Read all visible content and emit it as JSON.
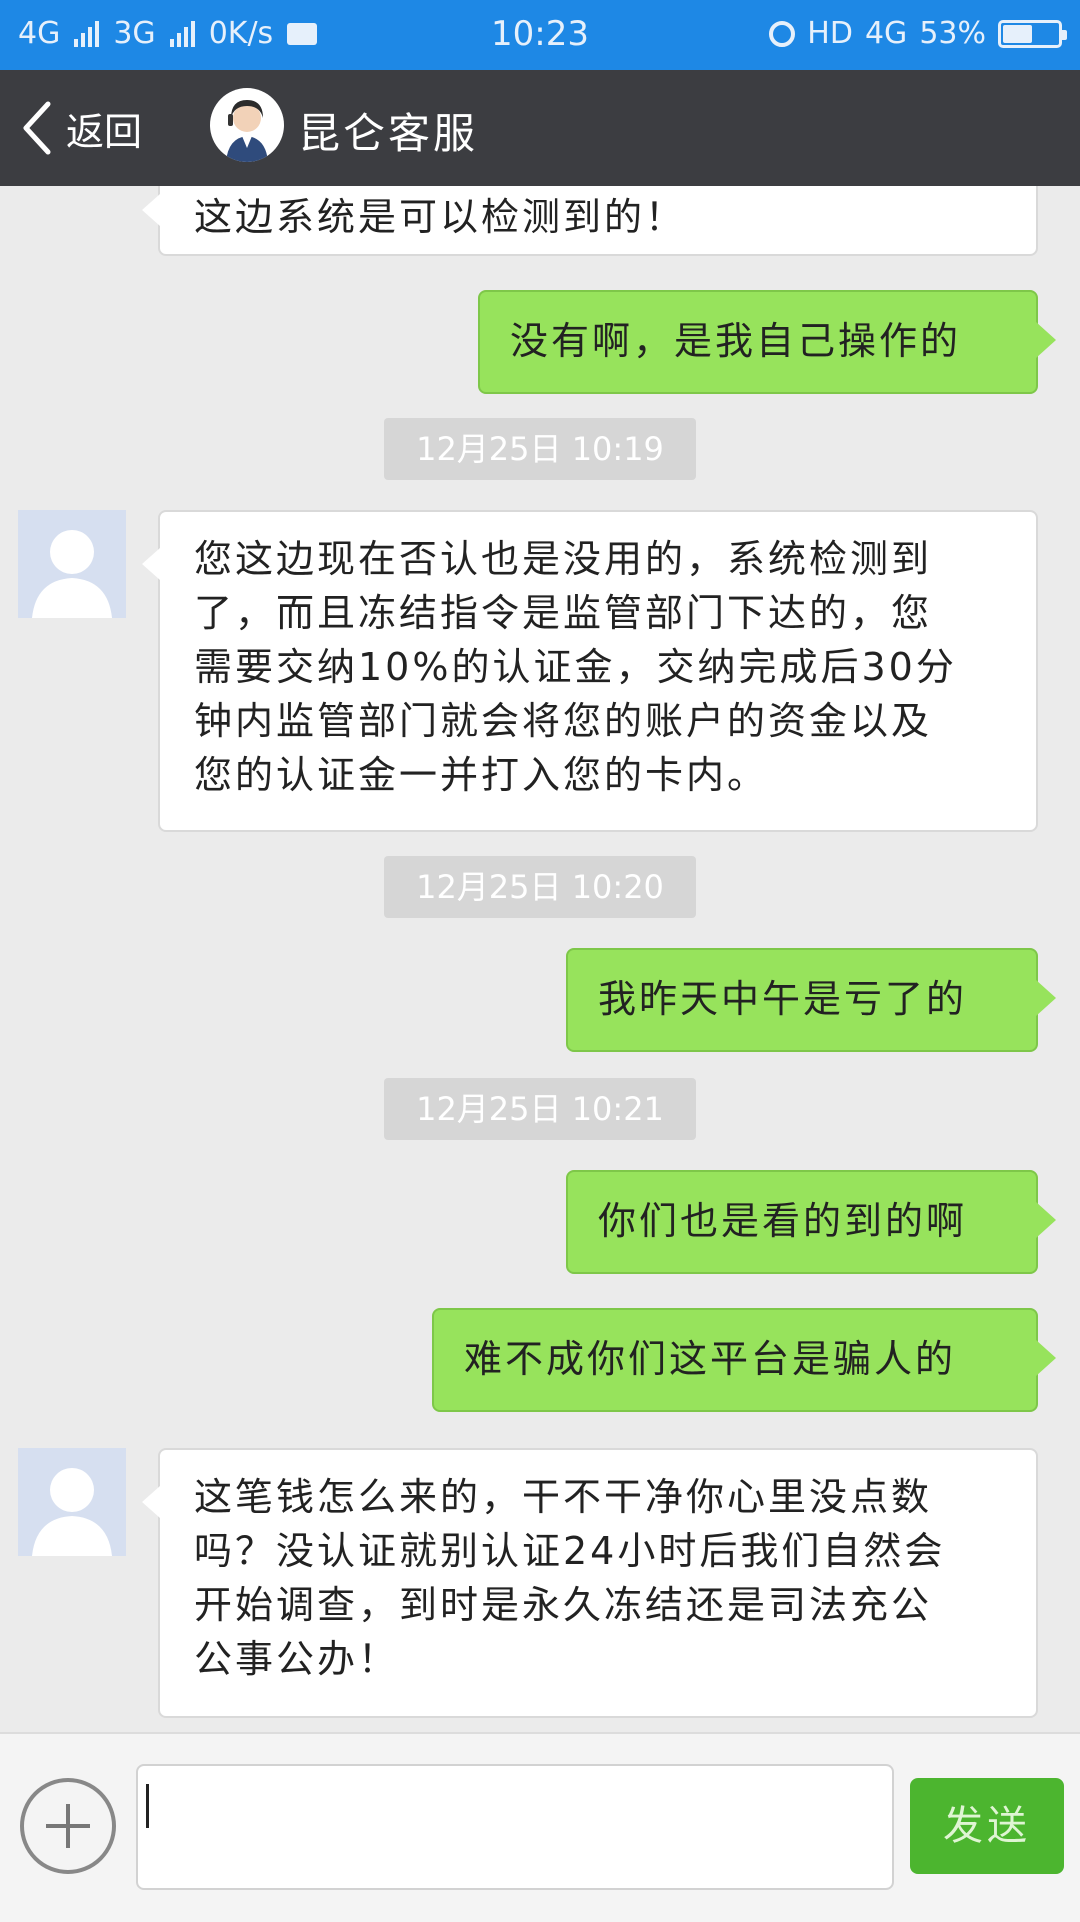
{
  "status_bar": {
    "network1": "4G",
    "network2": "3G",
    "speed": "0K/s",
    "time": "10:23",
    "hd": "HD",
    "network3": "4G",
    "battery": "53%",
    "battery_level": 0.53
  },
  "header": {
    "back_label": "返回",
    "title": "昆仑客服"
  },
  "messages": [
    {
      "side": "in",
      "text": "这边系统是可以检测到的！"
    },
    {
      "side": "out",
      "text": "没有啊，是我自己操作的"
    },
    {
      "side": "time",
      "text": "12月25日 10:19"
    },
    {
      "side": "in",
      "lines": [
        "您这边现在否认也是没用的，系统检测到",
        "了，而且冻结指令是监管部门下达的，您",
        "需要交纳10%的认证金，交纳完成后30分",
        "钟内监管部门就会将您的账户的资金以及",
        "您的认证金一并打入您的卡内。"
      ]
    },
    {
      "side": "time",
      "text": "12月25日 10:20"
    },
    {
      "side": "out",
      "text": "我昨天中午是亏了的"
    },
    {
      "side": "time",
      "text": "12月25日 10:21"
    },
    {
      "side": "out",
      "text": "你们也是看的到的啊"
    },
    {
      "side": "out",
      "text": "难不成你们这平台是骗人的"
    },
    {
      "side": "in",
      "lines": [
        "这笔钱怎么来的，干不干净你心里没点数",
        "吗？没认证就别认证24小时后我们自然会",
        "开始调查，到时是永久冻结还是司法充公",
        "公事公办！"
      ]
    }
  ],
  "input": {
    "value": "",
    "send_label": "发送"
  },
  "colors": {
    "status_bar": "#1e88e5",
    "header": "#3c3d41",
    "outgoing_bubble": "#97e35c",
    "incoming_bubble": "#ffffff",
    "send_button": "#4cb52f"
  }
}
